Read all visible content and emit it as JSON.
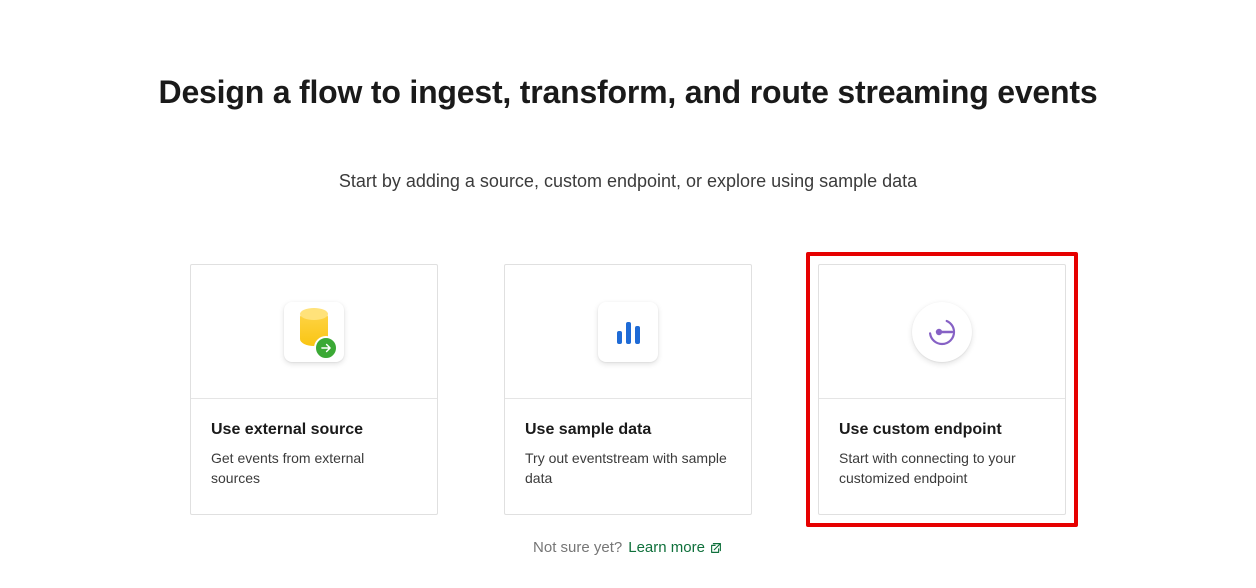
{
  "heading": "Design a flow to ingest, transform, and route streaming events",
  "subheading": "Start by adding a source, custom endpoint, or explore using sample data",
  "cards": [
    {
      "title": "Use external source",
      "description": "Get events from external sources"
    },
    {
      "title": "Use sample data",
      "description": "Try out eventstream with sample data"
    },
    {
      "title": "Use custom endpoint",
      "description": "Start with connecting to your customized endpoint"
    }
  ],
  "footer": {
    "prompt": "Not sure yet?",
    "link_label": "Learn more"
  },
  "highlighted_card_index": 2
}
